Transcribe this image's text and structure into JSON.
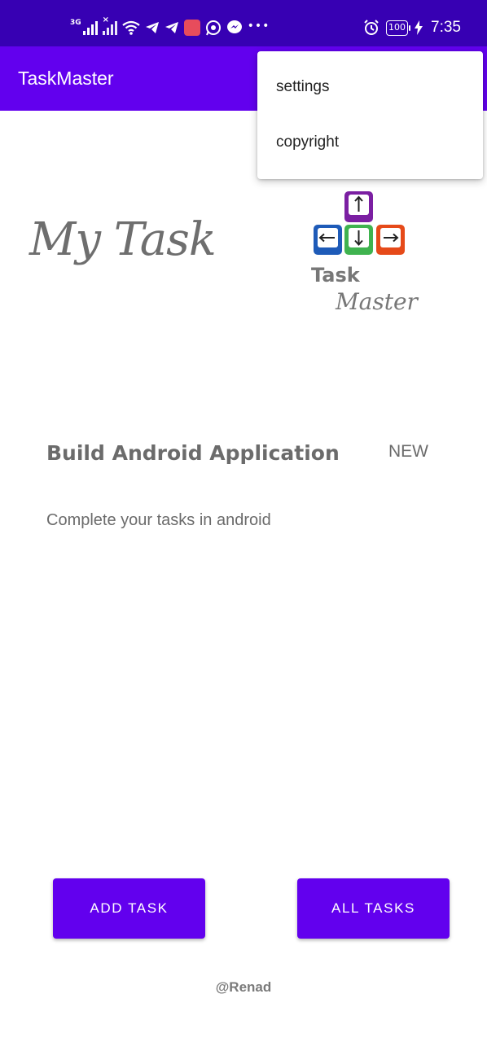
{
  "status_bar": {
    "network_label": "3G",
    "time": "7:35",
    "battery": "100",
    "icons": [
      "signal-icon",
      "signal-no-sim-icon",
      "wifi-icon",
      "telegram-icon",
      "telegram-icon",
      "app-icon",
      "whatsapp-icon",
      "messenger-icon",
      "more-dots-icon",
      "alarm-icon",
      "battery-icon",
      "charging-icon"
    ]
  },
  "app_bar": {
    "title": "TaskMaster"
  },
  "menu": {
    "items": [
      {
        "label": "settings"
      },
      {
        "label": "copyright"
      }
    ]
  },
  "header": {
    "heading": "My Task",
    "logo_line1": "Task",
    "logo_line2": "Master",
    "logo_colors": [
      "#7B1FA2",
      "#1E5BB8",
      "#3FB34F",
      "#E64A19"
    ]
  },
  "task": {
    "title": "Build Android Application",
    "state": "NEW",
    "description": "Complete your tasks in android"
  },
  "buttons": {
    "add_task": "ADD TASK",
    "all_tasks": "ALL TASKS"
  },
  "footer": {
    "text": "@Renad"
  },
  "colors": {
    "status_bar": "#3700B3",
    "primary": "#6200EE",
    "text_gray": "#6b6b6b"
  }
}
